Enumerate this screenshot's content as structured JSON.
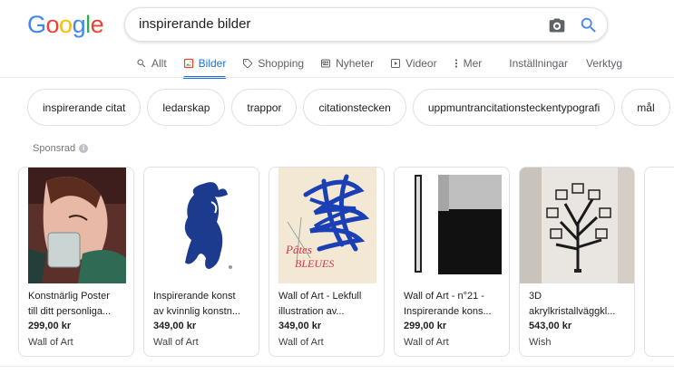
{
  "logo": {
    "letters": [
      "G",
      "o",
      "o",
      "g",
      "l",
      "e"
    ],
    "colors": [
      "#4285F4",
      "#EA4335",
      "#FBBC05",
      "#4285F4",
      "#34A853",
      "#EA4335"
    ]
  },
  "search": {
    "query": "inspirerande bilder"
  },
  "tabs": [
    {
      "label": "Allt",
      "icon": "search-icon"
    },
    {
      "label": "Bilder",
      "icon": "image-icon",
      "active": true
    },
    {
      "label": "Shopping",
      "icon": "tag-icon"
    },
    {
      "label": "Nyheter",
      "icon": "news-icon"
    },
    {
      "label": "Videor",
      "icon": "play-icon"
    },
    {
      "label": "Mer",
      "icon": "more-vert-icon"
    }
  ],
  "tools": {
    "settings": "Inställningar",
    "tools": "Verktyg"
  },
  "chips": [
    "inspirerande citat",
    "ledarskap",
    "trappor",
    "citationstecken",
    "uppmuntrancitationsteckentypografi",
    "mål"
  ],
  "sponsored_label": "Sponsrad",
  "products": [
    {
      "title_line1": "Konstnärlig Poster",
      "title_line2": "till ditt personliga...",
      "price": "299,00 kr",
      "merchant": "Wall of Art"
    },
    {
      "title_line1": "Inspirerande konst",
      "title_line2": "av kvinnlig konstn...",
      "price": "349,00 kr",
      "merchant": "Wall of Art"
    },
    {
      "title_line1": "Wall of Art - Lekfull",
      "title_line2": "illustration av...",
      "price": "349,00 kr",
      "merchant": "Wall of Art"
    },
    {
      "title_line1": "Wall of Art - n°21 -",
      "title_line2": "Inspirerande kons...",
      "price": "299,00 kr",
      "merchant": "Wall of Art"
    },
    {
      "title_line1": "3D",
      "title_line2": "akrylkristallväggkl...",
      "price": "543,00 kr",
      "merchant": "Wish"
    },
    {
      "title_line1": "",
      "title_line2": "",
      "price": "",
      "merchant": ""
    }
  ],
  "poster_text": {
    "line1": "Pâtes",
    "line2": "BLEUES"
  },
  "colors": {
    "accent": "#1a73e8",
    "tab_text": "#5f6368",
    "border": "#dfe1e5"
  }
}
